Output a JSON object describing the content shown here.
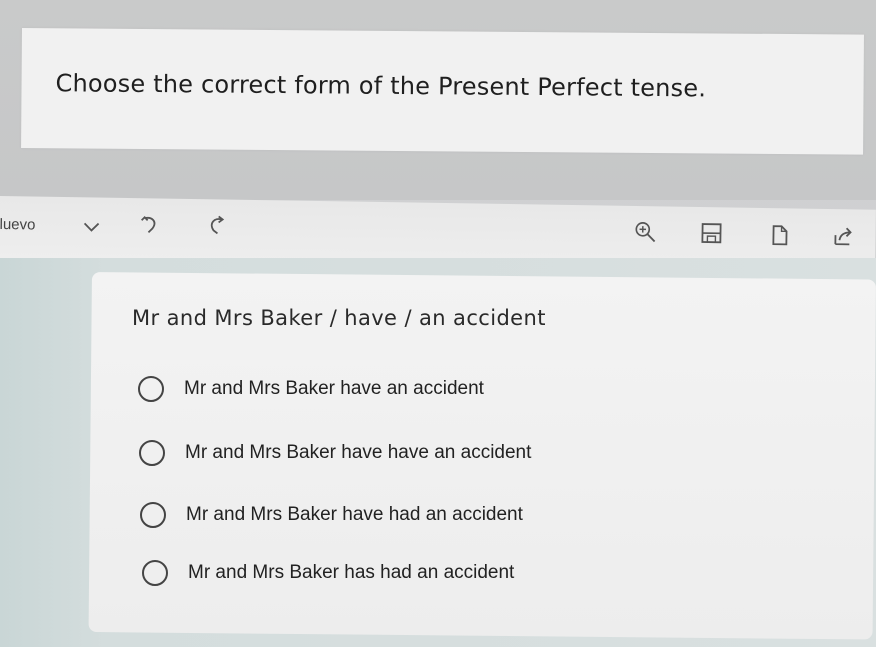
{
  "instruction": "Choose the correct form of the Present Perfect tense.",
  "toolbar": {
    "label": "luevo",
    "icons": [
      "chevron-down-icon",
      "undo-icon",
      "redo-icon",
      "zoom-in-icon",
      "save-icon",
      "copy-icon",
      "share-icon"
    ]
  },
  "question": {
    "prompt": "Mr and Mrs Baker / have / an accident",
    "options": [
      {
        "label": "Mr and Mrs Baker have an accident"
      },
      {
        "label": "Mr and Mrs Baker have have an accident"
      },
      {
        "label": "Mr and Mrs Baker have had an accident"
      },
      {
        "label": "Mr and Mrs Baker has had an accident"
      }
    ]
  }
}
